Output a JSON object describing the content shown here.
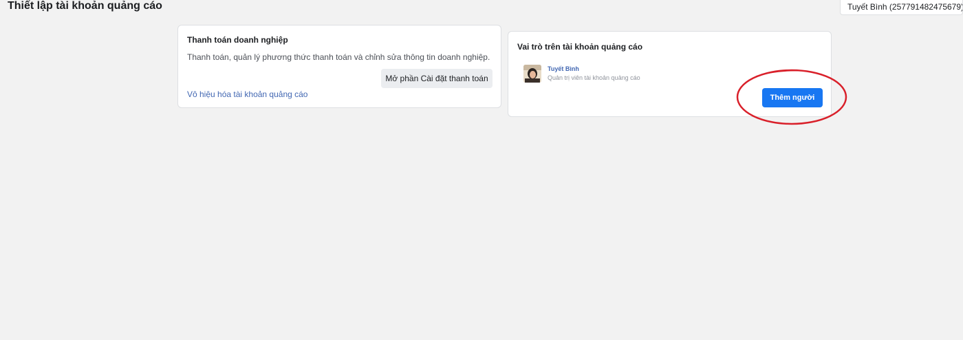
{
  "page": {
    "title": "Thiết lập tài khoản quảng cáo"
  },
  "account_selector": {
    "label": "Tuyết Bình (257791482475679)"
  },
  "business_payment_card": {
    "title": "Thanh toán doanh nghiệp",
    "description": "Thanh toán, quản lý phương thức thanh toán và chỉnh sửa thông tin doanh nghiệp.",
    "open_settings_button": "Mở phần Cài đặt thanh toán",
    "deactivate_link": "Vô hiệu hóa tài khoản quảng cáo"
  },
  "roles_card": {
    "title": "Vai trò trên tài khoản quảng cáo",
    "members": [
      {
        "name": "Tuyết Bình",
        "role": "Quản trị viên tài khoản quảng cáo",
        "avatar": "user-avatar"
      }
    ],
    "add_person_button": "Thêm người"
  },
  "annotation": {
    "shape": "ellipse",
    "color": "#d9202a",
    "target": "add-person-button"
  },
  "colors": {
    "primary": "#1877f2",
    "link": "#4267b2",
    "background": "#f2f2f2"
  }
}
